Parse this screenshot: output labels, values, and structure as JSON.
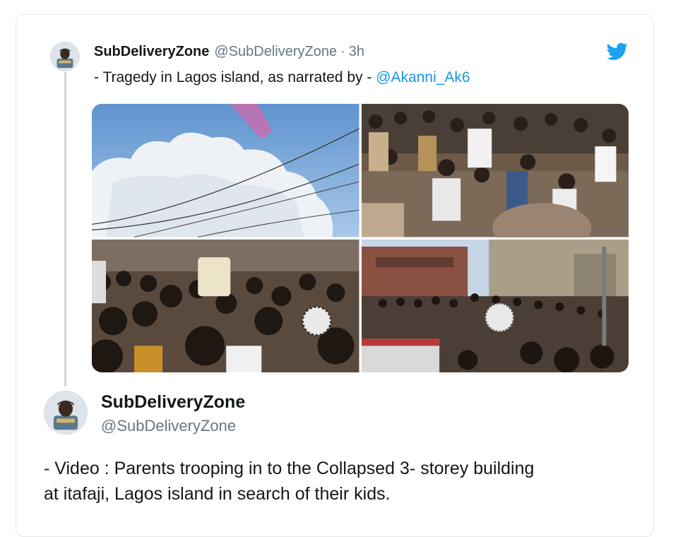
{
  "quoted_tweet": {
    "display_name": "SubDeliveryZone",
    "handle": "@SubDeliveryZone",
    "separator": "·",
    "time": "3h",
    "text_prefix": "- Tragedy in Lagos island, as narrated by - ",
    "mention": "@Akanni_Ak6",
    "icon": "twitter-bird-icon",
    "photos": [
      {
        "name": "photo-sky-clouds"
      },
      {
        "name": "photo-crowd-rubble"
      },
      {
        "name": "photo-crowd-street"
      },
      {
        "name": "photo-crowd-building"
      }
    ]
  },
  "main_tweet": {
    "display_name": "SubDeliveryZone",
    "handle": "@SubDeliveryZone",
    "text_line1": "- Video : Parents trooping in to the Collapsed 3- storey building",
    "text_line2": "at itafaji, Lagos island in search of their kids."
  },
  "colors": {
    "link": "#1b95e0",
    "twitter_blue": "#1da1f2",
    "muted": "#657786",
    "border": "#e1e8ed"
  }
}
